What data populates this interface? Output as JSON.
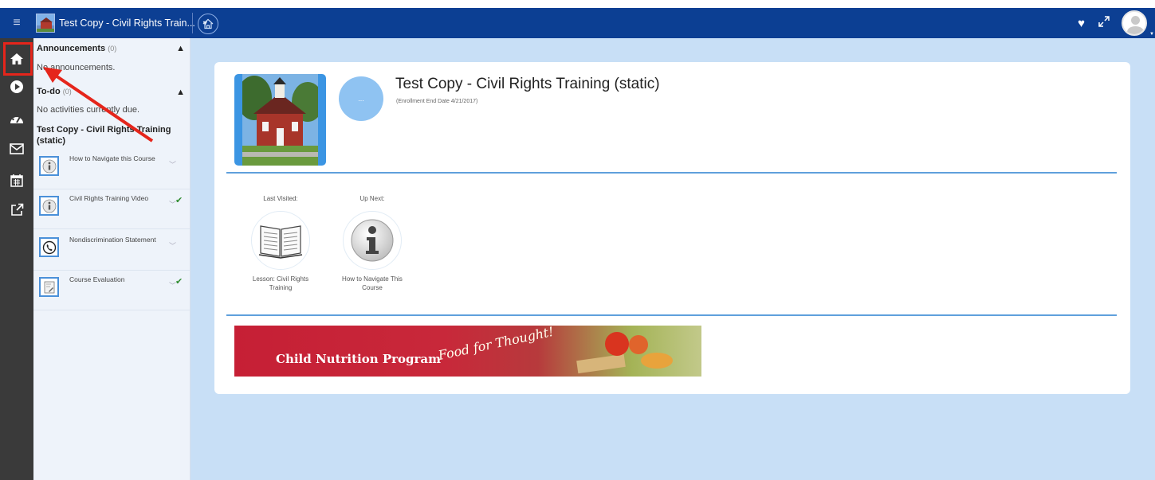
{
  "topbar": {
    "course_selector": "Test Copy - Civil Rights Train...",
    "menu_icon": "hamburger-icon",
    "home_icon": "home-icon",
    "favorite_icon": "heart-icon",
    "fullscreen_icon": "expand-icon",
    "avatar_icon": "user-avatar"
  },
  "rail": {
    "items": [
      "home-icon",
      "play-icon",
      "dashboard-icon",
      "mail-icon",
      "calendar-icon",
      "external-link-icon"
    ]
  },
  "panel": {
    "announcements": {
      "label": "Announcements",
      "count": "(0)",
      "empty_text": "No announcements."
    },
    "todo": {
      "label": "To-do",
      "count": "(0)",
      "empty_text": "No activities currently due."
    },
    "course_title": "Test Copy - Civil Rights Training (static)",
    "activities": [
      {
        "label": "How to Navigate this Course",
        "icon": "info-icon",
        "done": false
      },
      {
        "label": "Civil Rights Training Video",
        "icon": "info-icon",
        "done": true
      },
      {
        "label": "Nondiscrimination Statement",
        "icon": "phone-icon",
        "done": false
      },
      {
        "label": "Course Evaluation",
        "icon": "evaluation-icon",
        "done": true
      }
    ]
  },
  "main": {
    "title": "Test Copy - Civil Rights Training (static)",
    "subtitle": "(Enrollment End Date 4/21/2017)",
    "avatar_text": "...",
    "last_visited": {
      "caption": "Last Visited:",
      "name": "Lesson: Civil Rights Training",
      "icon": "book-icon"
    },
    "up_next": {
      "caption": "Up Next:",
      "name": "How to Navigate This Course",
      "icon": "info-icon"
    },
    "banner": {
      "text1": "Child Nutrition Program",
      "text2": "Food for Thought!"
    }
  },
  "colors": {
    "topbar": "#0c3f93",
    "rail": "#3a3a3a",
    "main_bg": "#c8dff6",
    "accent": "#3b95e3",
    "highlight": "#e5251b"
  }
}
